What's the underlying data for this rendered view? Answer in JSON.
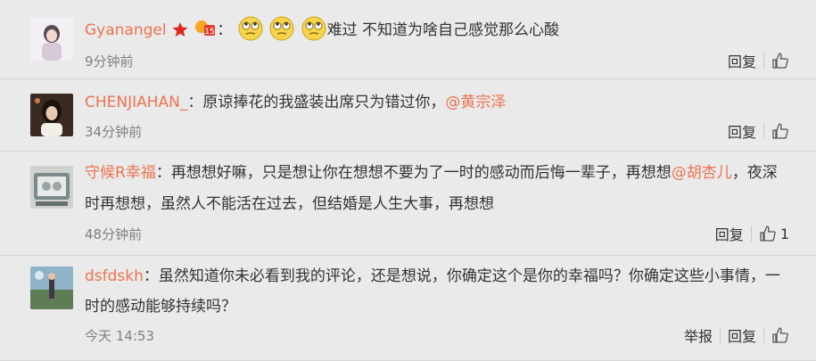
{
  "comments": [
    {
      "username": "Gyanangel",
      "colon": "：",
      "text": "难过 不知道为啥自己感觉那么心酸",
      "time": "9分钟前",
      "report": "",
      "reply": "回复",
      "likes": "",
      "icons": [
        "star-badge-icon",
        "vip-badge-icon",
        "rolling-eyes-emoji-icon"
      ]
    },
    {
      "username": "CHENJIAHAN_",
      "colon": "：",
      "text": "原谅捧花的我盛装出席只为错过你，",
      "mention": "@黄宗泽",
      "time": "34分钟前",
      "reply": "回复",
      "likes": ""
    },
    {
      "username": "守候R幸福",
      "colon": "：",
      "text": "再想想好嘛，只是想让你在想想不要为了一时的感动而后悔一辈子，再想想",
      "mention": "@胡杏儿",
      "text2": "，夜深时再想想，虽然人不能活在过去，但结婚是人生大事，再想想",
      "time": "48分钟前",
      "reply": "回复",
      "likes": "1"
    },
    {
      "username": "dsfdskh",
      "colon": "：",
      "text": "虽然知道你未必看到我的评论，还是想说，你确定这个是你的幸福吗？你确定这些小事情，一时的感动能够持续吗？",
      "time": "今天 14:53",
      "report": "举报",
      "reply": "回复",
      "likes": ""
    }
  ],
  "colors": {
    "background": "#eaeaea",
    "username": "#eb7350",
    "text": "#333333",
    "muted": "#808080"
  }
}
